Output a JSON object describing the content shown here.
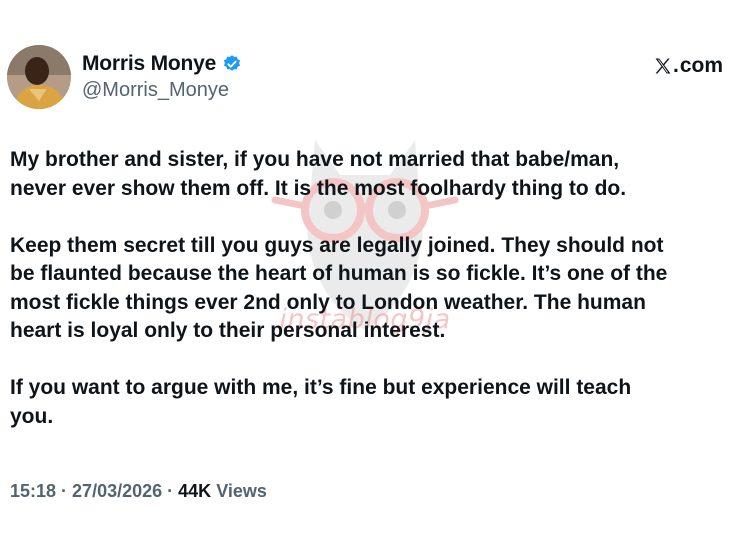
{
  "author": {
    "display_name": "Morris Monye",
    "handle": "@Morris_Monye",
    "verified": true,
    "avatar_icon": "profile-photo"
  },
  "source_label": "com",
  "source_icon": "x-logo-icon",
  "tweet": {
    "paragraphs": [
      "My brother and sister, if you have not married that babe/man,\nnever ever show them off. It is the most foolhardy thing to do.",
      "Keep them secret till you guys are legally joined. They should not\nbe flaunted because the heart of human is so fickle. It’s one of the\nmost fickle things ever 2nd only to London weather. The human\nheart is loyal only to their personal interest.",
      "If you want to argue with me, it’s fine but experience will teach\nyou."
    ]
  },
  "meta": {
    "time": "15:18",
    "separator": " · ",
    "date": "27/03/2026",
    "views_count": "44K",
    "views_label": "Views"
  },
  "watermark": {
    "text": "instablog9ja",
    "icon": "owl-logo-icon"
  },
  "colors": {
    "verified_blue": "#1d9bf0",
    "muted_text": "#536471",
    "primary_text": "#0f1419",
    "watermark_pink": "#ec9696"
  }
}
